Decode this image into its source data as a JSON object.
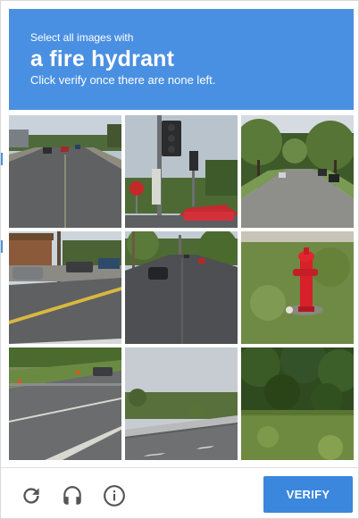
{
  "header": {
    "instruction": "Select all images with",
    "target": "a fire hydrant",
    "hint": "Click verify once there are none left."
  },
  "tiles": [
    {
      "subject": "road-with-cars"
    },
    {
      "subject": "traffic-light-stop-sign"
    },
    {
      "subject": "residential-street"
    },
    {
      "subject": "street-with-pickup-truck"
    },
    {
      "subject": "road-with-cars-distance"
    },
    {
      "subject": "fire-hydrant"
    },
    {
      "subject": "highway-with-cones"
    },
    {
      "subject": "highway-with-barrier"
    },
    {
      "subject": "trees-and-grass"
    }
  ],
  "footer": {
    "reload_icon": "reload-icon",
    "audio_icon": "headphones-icon",
    "info_icon": "info-icon",
    "verify_label": "VERIFY"
  },
  "colors": {
    "header_bg": "#4a90e2",
    "button_bg": "#3b87dd",
    "icon_gray": "#555555"
  }
}
